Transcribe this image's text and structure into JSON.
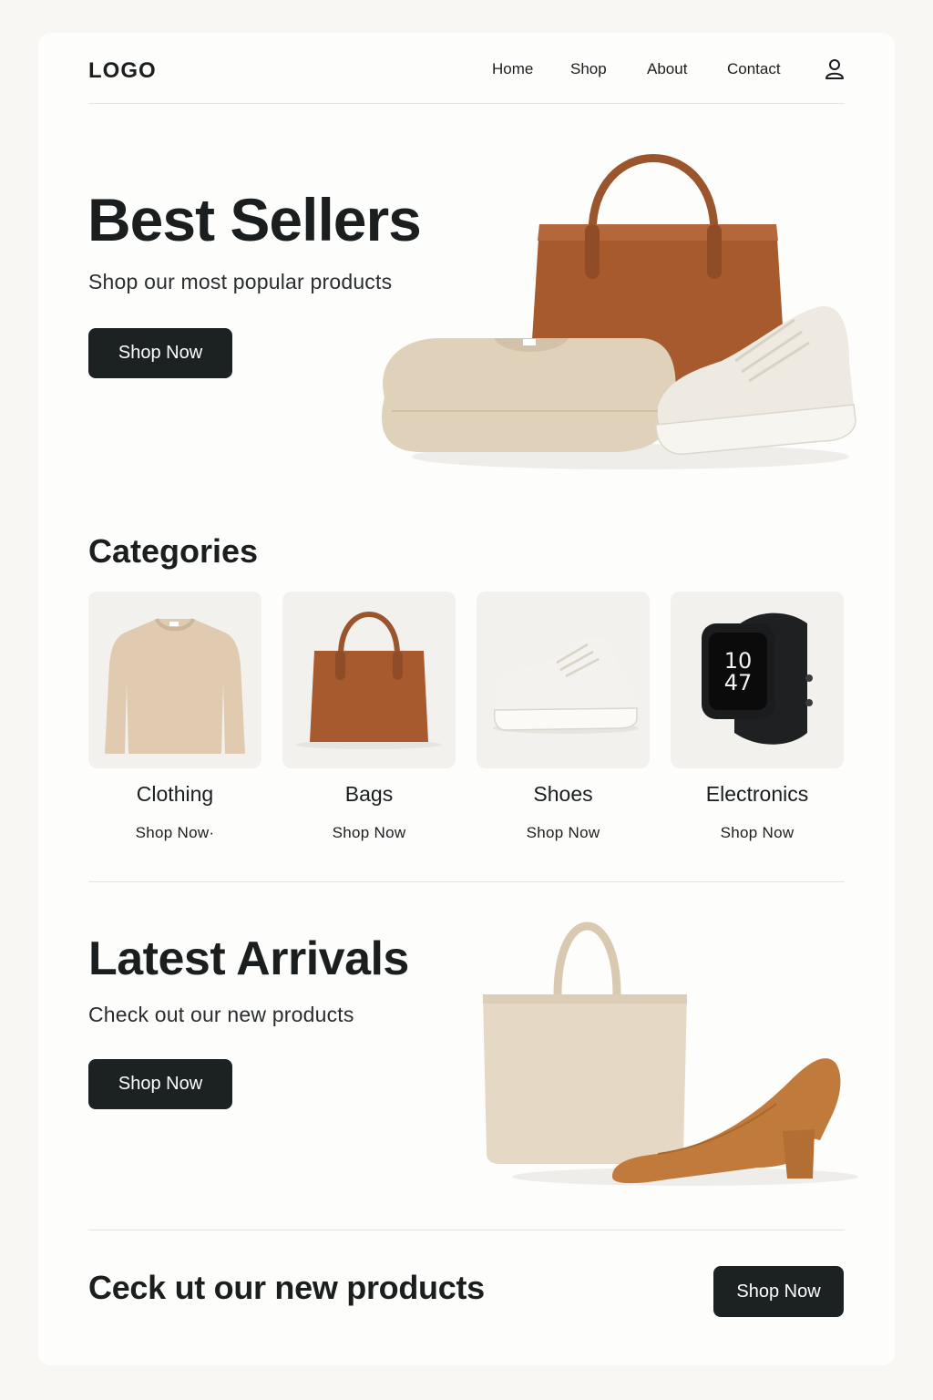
{
  "header": {
    "logo": "LOGO",
    "nav": [
      "Home",
      "Shop",
      "About",
      "Contact"
    ],
    "user_icon": "user-icon"
  },
  "hero": {
    "title": "Best Sellers",
    "subtitle": "Shop our most popular products",
    "button": "Shop Now"
  },
  "categories": {
    "title": "Categories",
    "items": [
      {
        "name": "Clothing",
        "link": "Shop Now·",
        "icon": "sweater-image"
      },
      {
        "name": "Bags",
        "link": "Shop Now",
        "icon": "handbag-image"
      },
      {
        "name": "Shoes",
        "link": "Shop Now",
        "icon": "sneaker-image"
      },
      {
        "name": "Electronics",
        "link": "Shop Now",
        "icon": "smartwatch-image"
      }
    ],
    "watch_time": [
      "10",
      "47"
    ]
  },
  "arrivals": {
    "title": "Latest Arrivals",
    "subtitle": "Check out our new products",
    "button": "Shop Now"
  },
  "banner": {
    "text": "Ceck ut our new products",
    "button": "Shop Now"
  },
  "colors": {
    "background": "#f8f7f4",
    "surface": "#fdfdfc",
    "button": "#1c2122",
    "leather": "#a65a2e",
    "beige": "#e2d3bd",
    "suede": "#c07a3c"
  }
}
